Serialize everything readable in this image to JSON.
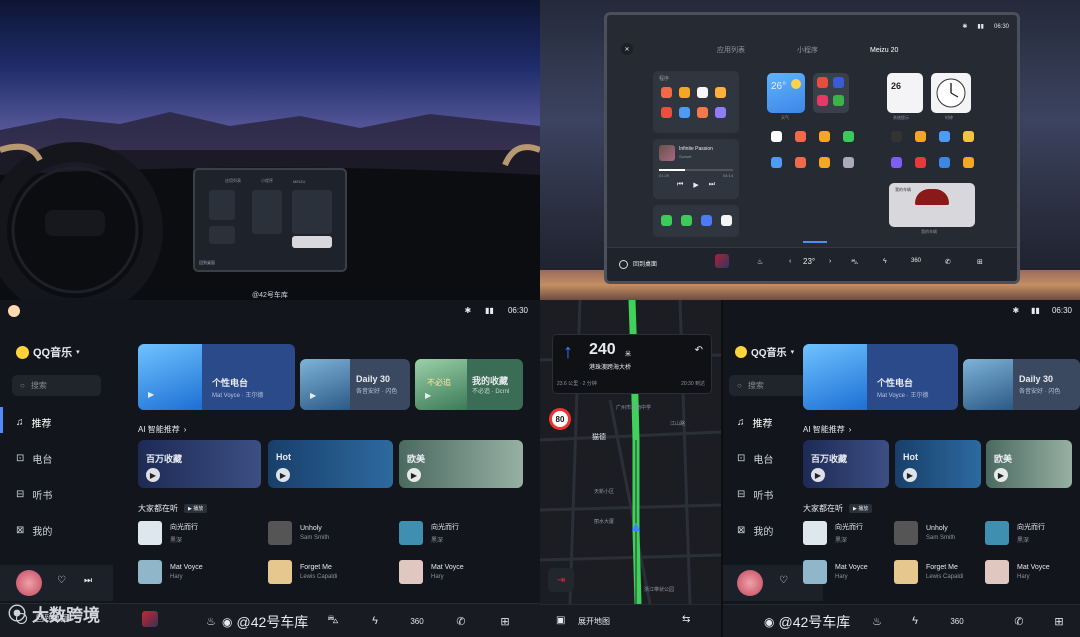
{
  "top_left": {
    "watermark": "@42号车库",
    "mini_screen": {
      "tabs": [
        "应用列表",
        "小程序",
        "MEIZU"
      ],
      "dock_left": "回到桌面"
    }
  },
  "top_right": {
    "status": {
      "time": "06:30"
    },
    "tabs": [
      "应用列表",
      "小程序",
      "Meizu 20"
    ],
    "weather": {
      "temp": "26°",
      "label": "天气"
    },
    "calendar": {
      "date": "26",
      "label": "系统提示"
    },
    "clock": {
      "label": "时钟"
    },
    "player": {
      "title": "Infinite Passion",
      "artist": "Sunset",
      "elapsed": "01:29",
      "total": "04:14"
    },
    "group_label": "程序",
    "apps_row1": [
      "25",
      "天气",
      "文件管理",
      "车机助手",
      "NAVI",
      "Flyme Play",
      "屏幕投影",
      "应用商店"
    ],
    "apps_row2": [
      "应用商店",
      "游戏中心",
      "全部图标",
      "设置",
      "QQ音乐",
      "视频",
      "车机助手",
      "随时拍"
    ],
    "car_card": {
      "title": "我的车辆",
      "label": "我的车辆"
    },
    "dock": {
      "home_label": "回到桌面",
      "temp": "23°"
    }
  },
  "bottom_left": {
    "status": {
      "time": "06:30"
    },
    "brand": "QQ音乐",
    "search_placeholder": "搜索",
    "sidebar": [
      {
        "label": "推荐",
        "icon": "music-note-icon",
        "active": true
      },
      {
        "label": "电台",
        "icon": "radio-icon",
        "active": false
      },
      {
        "label": "听书",
        "icon": "book-icon",
        "active": false
      },
      {
        "label": "我的",
        "icon": "profile-icon",
        "active": false
      }
    ],
    "hero": [
      {
        "title": "个性电台",
        "subtitle": "Mat Voyce · 王尔德"
      },
      {
        "title": "Daily 30",
        "subtitle": "各音安好 · 闪色"
      },
      {
        "title": "我的收藏",
        "subtitle": "不必追 · Dcrnl",
        "cover_text": "不必追"
      }
    ],
    "ai_title": "AI 智能推荐",
    "ai_cards": [
      {
        "title": "百万收藏"
      },
      {
        "title": "Hot"
      },
      {
        "title": "欧美"
      }
    ],
    "listening_title": "大家都在听",
    "listening_badge": "▶ 播放",
    "songs": [
      {
        "name": "向光而行",
        "artist": "黑深"
      },
      {
        "name": "Unholy",
        "artist": "Sam Smith"
      },
      {
        "name": "向光而行",
        "artist": "黑深"
      },
      {
        "name": "Mat Voyce",
        "artist": "Hary"
      },
      {
        "name": "Forget Me",
        "artist": "Lewis Capaldi"
      },
      {
        "name": "Mat Voyce",
        "artist": "Hary"
      }
    ],
    "dock": {
      "home_label": "回到桌面"
    }
  },
  "bottom_mid": {
    "nav": {
      "distance": "240",
      "unit": "米",
      "road": "港珠澳跨海大桥",
      "remain": "23.6 公里 · 2 分钟",
      "eta": "20:30 到达"
    },
    "speed_limit": "80",
    "street": "猫德",
    "labels": [
      "广州市华南中学",
      "天新小区",
      "丽水大厦",
      "江山路",
      "浙江带状公园"
    ],
    "dock": {
      "expand_label": "展开地图"
    }
  },
  "bottom_right": {
    "status": {
      "time": "06:30"
    },
    "brand": "QQ音乐",
    "search_placeholder": "搜索",
    "sidebar": [
      "推荐",
      "电台",
      "听书",
      "我的"
    ],
    "hero": [
      {
        "title": "个性电台",
        "subtitle": "Mat Voyce · 王尔德"
      },
      {
        "title": "Daily 30",
        "subtitle": "各音安好 · 闪色"
      }
    ],
    "ai_title": "AI 智能推荐",
    "ai_cards": [
      "百万收藏",
      "Hot",
      "欧美"
    ],
    "listening_title": "大家都在听",
    "listening_badge": "▶ 播放",
    "songs": [
      {
        "name": "向光而行",
        "artist": "黑深"
      },
      {
        "name": "Unholy",
        "artist": "Sam Smith"
      },
      {
        "name": "向光而行",
        "artist": "黑深"
      },
      {
        "name": "Mat Voyce",
        "artist": "Hary"
      },
      {
        "name": "Forget Me",
        "artist": "Lewis Capaldi"
      },
      {
        "name": "Mat Voyce",
        "artist": "Hary"
      }
    ]
  },
  "overlays": {
    "logo_text": "大数跨境",
    "watermark": "@42号车库"
  },
  "colors": {
    "accent": "#4f8cff",
    "panel": "#1c2129",
    "bg": "#12151b"
  }
}
